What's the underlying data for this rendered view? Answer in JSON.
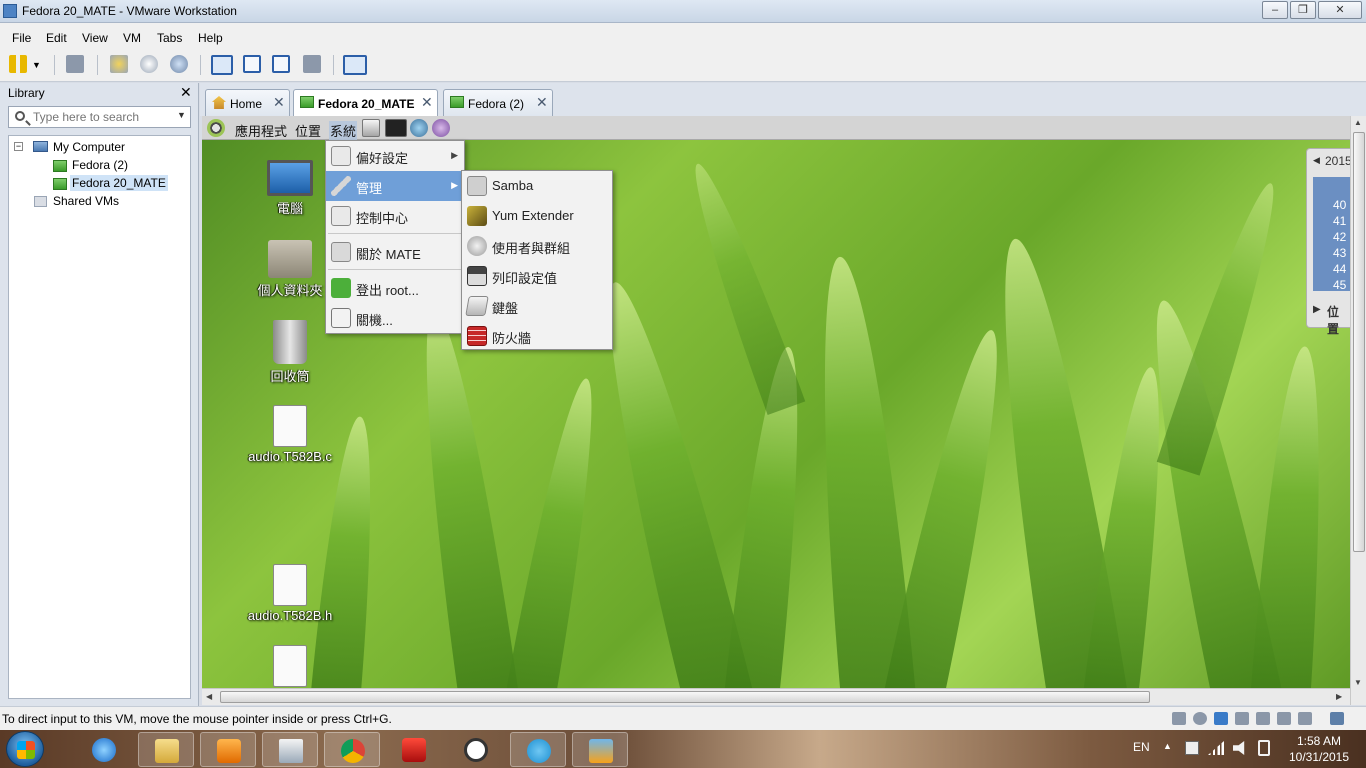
{
  "window": {
    "title": "Fedora 20_MATE - VMware Workstation"
  },
  "menubar": [
    "File",
    "Edit",
    "View",
    "VM",
    "Tabs",
    "Help"
  ],
  "library": {
    "title": "Library",
    "search_placeholder": "Type here to search",
    "tree": {
      "root": "My Computer",
      "children": [
        "Fedora (2)",
        "Fedora 20_MATE"
      ],
      "selected": "Fedora 20_MATE",
      "shared": "Shared VMs"
    }
  },
  "tabs": [
    {
      "label": "Home",
      "icon": "home-icon"
    },
    {
      "label": "Fedora 20_MATE",
      "icon": "vm-icon",
      "active": true
    },
    {
      "label": "Fedora (2)",
      "icon": "vm-icon"
    }
  ],
  "guest": {
    "panel_menus": [
      "應用程式",
      "位置",
      "系統"
    ],
    "desktop_icons": [
      {
        "label": "電腦",
        "icon": "computer-icon"
      },
      {
        "label": "個人資料夾",
        "icon": "home-folder-icon"
      },
      {
        "label": "回收筒",
        "icon": "trash-icon"
      },
      {
        "label": "audio.T582B.c",
        "icon": "document-icon"
      },
      {
        "label": "audio.T582B.h",
        "icon": "document-icon"
      },
      {
        "label": "",
        "icon": "document-icon"
      }
    ],
    "system_menu": [
      {
        "label": "偏好設定",
        "submenu": true
      },
      {
        "label": "管理",
        "submenu": true,
        "highlighted": true
      },
      {
        "label": "控制中心"
      },
      {
        "label": "關於 MATE"
      },
      {
        "label": "登出 root..."
      },
      {
        "label": "關機..."
      }
    ],
    "admin_submenu": [
      "Samba",
      "Yum Extender",
      "使用者與群組",
      "列印設定值",
      "鍵盤",
      "防火牆"
    ],
    "calendar": {
      "year": "2015",
      "weeks": [
        "40",
        "41",
        "42",
        "43",
        "44",
        "45"
      ],
      "location_label": "位置"
    }
  },
  "statusbar": {
    "text": "To direct input to this VM, move the mouse pointer inside or press Ctrl+G."
  },
  "taskbar": {
    "language": "EN",
    "time": "1:58 AM",
    "date": "10/31/2015"
  },
  "colors": {
    "menu_highlight": "#6f9fd8",
    "title_bar": "#dfe8f3"
  }
}
